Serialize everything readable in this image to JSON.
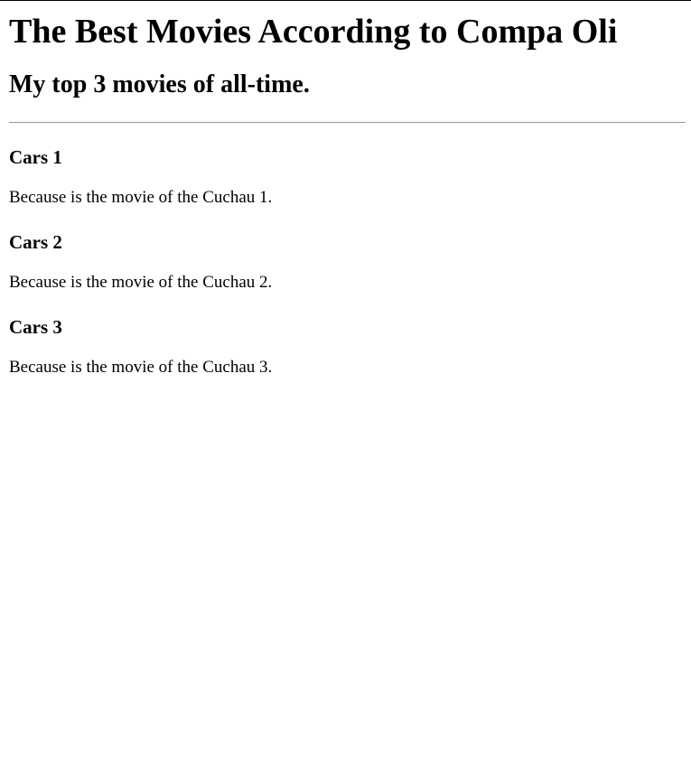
{
  "page": {
    "title": "The Best Movies According to Compa Oli",
    "subtitle": "My top 3 movies of all-time."
  },
  "movies": [
    {
      "name": "Cars 1",
      "reason": "Because is the movie of the Cuchau 1."
    },
    {
      "name": "Cars 2",
      "reason": "Because is the movie of the Cuchau 2."
    },
    {
      "name": "Cars 3",
      "reason": "Because is the movie of the Cuchau 3."
    }
  ]
}
